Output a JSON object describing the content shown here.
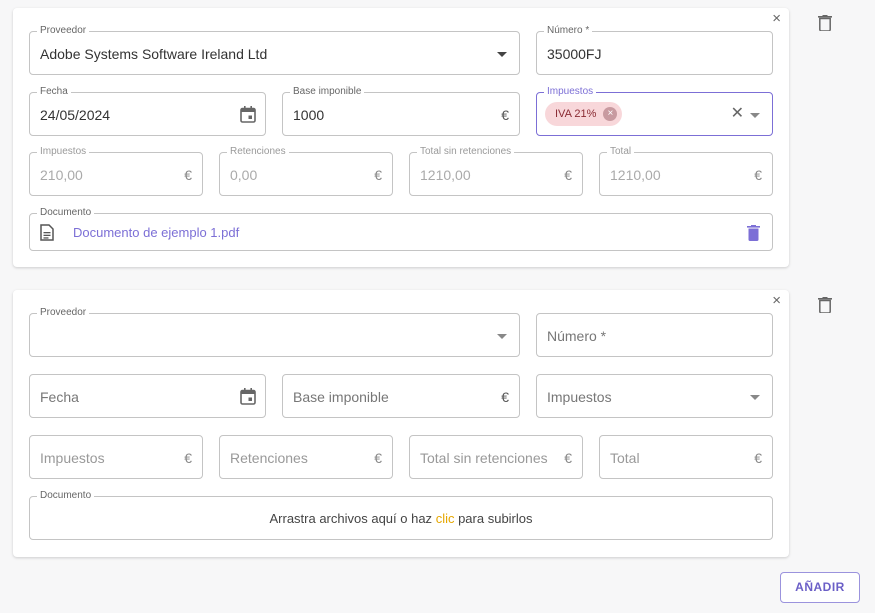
{
  "entries": [
    {
      "supplier": {
        "label": "Proveedor",
        "value": "Adobe Systems Software Ireland Ltd"
      },
      "number": {
        "label": "Número *",
        "value": "35000FJ"
      },
      "date": {
        "label": "Fecha",
        "value": "24/05/2024"
      },
      "base": {
        "label": "Base imponible",
        "value": "1000",
        "suffix": "€"
      },
      "taxes_select": {
        "label": "Impuestos",
        "chip": "IVA 21%"
      },
      "taxes_amount": {
        "label": "Impuestos",
        "value": "210,00",
        "suffix": "€"
      },
      "withholdings": {
        "label": "Retenciones",
        "value": "0,00",
        "suffix": "€"
      },
      "total_no_withholding": {
        "label": "Total sin retenciones",
        "value": "1210,00",
        "suffix": "€"
      },
      "total": {
        "label": "Total",
        "value": "1210,00",
        "suffix": "€"
      },
      "document": {
        "label": "Documento",
        "file_name": "Documento de ejemplo 1.pdf"
      },
      "close_glyph": "×",
      "chip_remove_glyph": "×",
      "clear_glyph": "✕"
    },
    {
      "supplier": {
        "label": "Proveedor"
      },
      "number": {
        "placeholder": "Número *"
      },
      "date": {
        "placeholder": "Fecha"
      },
      "base": {
        "placeholder": "Base imponible",
        "suffix": "€"
      },
      "taxes_select": {
        "placeholder": "Impuestos"
      },
      "taxes_amount": {
        "placeholder": "Impuestos",
        "suffix": "€"
      },
      "withholdings": {
        "placeholder": "Retenciones",
        "suffix": "€"
      },
      "total_no_withholding": {
        "placeholder": "Total sin retenciones",
        "suffix": "€"
      },
      "total": {
        "placeholder": "Total",
        "suffix": "€"
      },
      "document": {
        "label": "Documento",
        "drop_before": "Arrastra archivos aquí o haz ",
        "drop_link": "clic",
        "drop_after": " para subirlos"
      },
      "close_glyph": "×"
    }
  ],
  "icons": {
    "outside_delete": "trash-icon",
    "calendar": "calendar-icon",
    "document": "document-icon",
    "document_delete": "trash-icon"
  },
  "colors": {
    "accent": "#7c6fd6",
    "chip_bg": "#f8d7da",
    "chip_text": "#8a2b33",
    "upload_link": "#e6a700"
  },
  "actions": {
    "add_label": "AÑADIR"
  }
}
